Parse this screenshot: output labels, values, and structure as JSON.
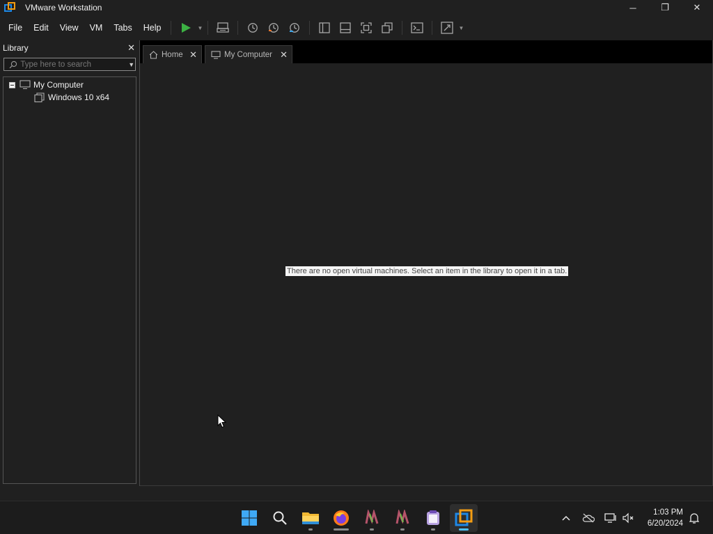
{
  "window": {
    "title": "VMware Workstation",
    "controls": {
      "minimize": "─",
      "restore": "❐",
      "close": "✕"
    }
  },
  "menu": {
    "items": [
      "File",
      "Edit",
      "View",
      "VM",
      "Tabs",
      "Help"
    ]
  },
  "toolbar": {
    "icons": [
      "play-icon",
      "send-ctrl-alt-del-icon",
      "snapshot-icon",
      "revert-snapshot-icon",
      "snapshot-manager-icon",
      "show-library-icon",
      "show-thumbnail-bar-icon",
      "full-screen-icon",
      "unity-icon",
      "console-view-icon",
      "stretch-guest-icon"
    ],
    "accent_play": "#3cb043"
  },
  "library": {
    "title": "Library",
    "close": "✕",
    "search_placeholder": "Type here to search",
    "tree": {
      "root": "My Computer",
      "children": [
        "Windows 10 x64"
      ]
    }
  },
  "tabs": [
    {
      "label": "Home",
      "icon": "home-icon",
      "close": "✕",
      "active": false
    },
    {
      "label": "My Computer",
      "icon": "computer-icon",
      "close": "✕",
      "active": true
    }
  ],
  "main": {
    "empty_message": "There are no open virtual machines. Select an item in the library to open it in a tab."
  },
  "taskbar": {
    "apps": [
      "start-icon",
      "search-icon",
      "file-explorer-icon",
      "firefox-icon",
      "notepad-plus-plus-icon",
      "notepad-plus-plus-icon",
      "notepad-icon",
      "vmware-workstation-icon"
    ],
    "active_app": "vmware-workstation-icon",
    "tray_icons": [
      "show-hidden-icons-chevron",
      "onedrive-icon",
      "network-icon",
      "volume-muted-icon",
      "notification-bell-icon"
    ],
    "clock": {
      "time": "1:03 PM",
      "date": "6/20/2024"
    },
    "indicator_color": "#4cc2ff"
  }
}
